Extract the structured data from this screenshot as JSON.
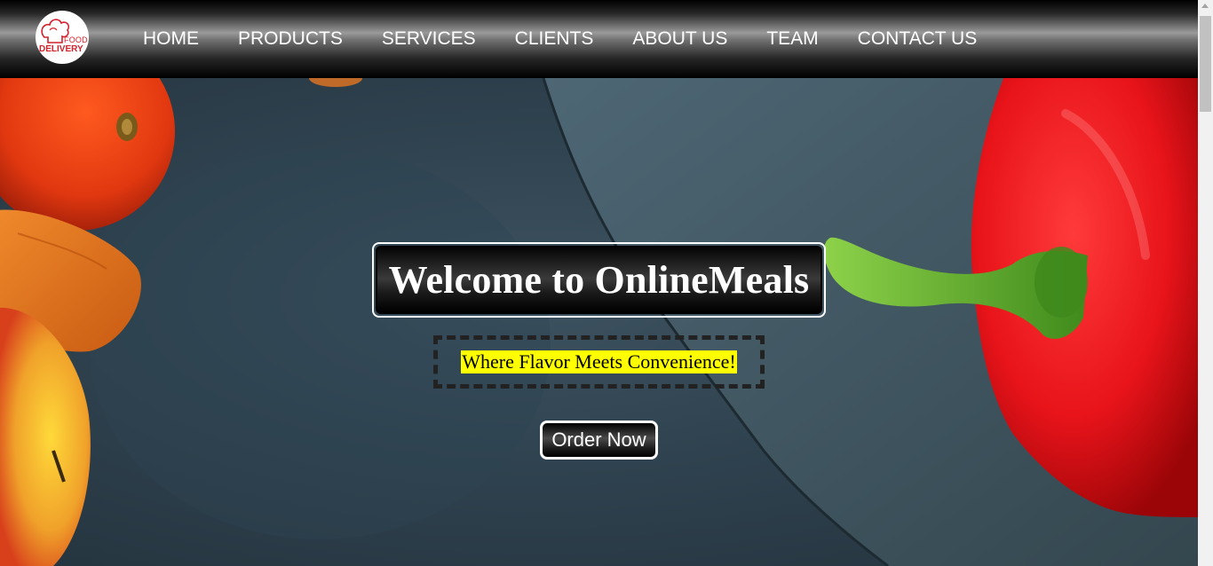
{
  "logo": {
    "line1": "FOOD",
    "line2": "DELIVERY"
  },
  "nav": {
    "items": [
      "HOME",
      "PRODUCTS",
      "SERVICES",
      "CLIENTS",
      "ABOUT US",
      "TEAM",
      "CONTACT US"
    ]
  },
  "hero": {
    "title": "Welcome to OnlineMeals",
    "tagline": "Where Flavor Meets Convenience!",
    "order_button": "Order Now"
  },
  "colors": {
    "tagline_highlight": "#ffff00",
    "logo_red": "#d4202a",
    "pepper_red": "#e8141a",
    "stem_green": "#5fae2a"
  }
}
